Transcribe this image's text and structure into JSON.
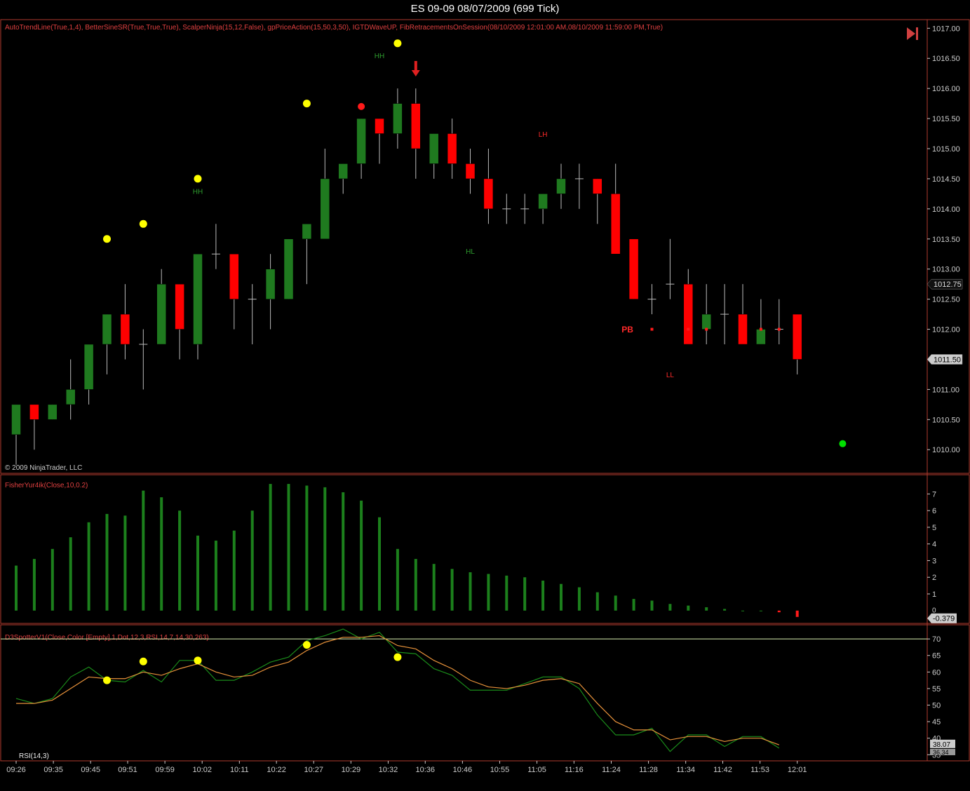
{
  "window": {
    "title": "ES 09-09  08/07/2009 (699 Tick)"
  },
  "price_panel": {
    "indicators_label": "AutoTrendLine(True,1,4), BetterSineSR(True,True,True), ScalperNinja(15,12,False), gpPriceAction(15,50,3,50), IGTDWaveUP, FibRetracementsOnSession(08/10/2009 12:01:00 AM,08/10/2009 11:59:00 PM,True)",
    "copyright": "© 2009 NinjaTrader, LLC",
    "current_price_box": "1011.50",
    "marker_price_box": "1012.75"
  },
  "fisher_panel": {
    "label": "FisherYur4ik(Close,10,0.2)",
    "value_box": "-0.379",
    "zero_label": "0"
  },
  "rsi_panel": {
    "label": "D3SpotterV1(Close,Color [Empty],1,Dot,12,3,RSI,14,7,14,30,263)",
    "rsi_label": "RSI(14,3)",
    "value_box_1": "38.07",
    "value_box_2": "36.34"
  },
  "colors": {
    "up": "#1f7a1f",
    "down": "#ff0000",
    "wick": "#bbbbbb",
    "border": "#b03a2e",
    "axis_text": "#cccccc",
    "yellow_dot": "#ffff00",
    "rsi_green": "#1a8c1a",
    "rsi_orange": "#e8923a",
    "level_line": "#d9f0b0"
  },
  "chart_data": [
    {
      "type": "candlestick",
      "ylim": [
        1009.7,
        1017.05
      ],
      "y_ticks": [
        "1010.00",
        "1010.50",
        "1011.00",
        "1011.50",
        "1012.00",
        "1012.50",
        "1013.00",
        "1013.50",
        "1014.00",
        "1014.50",
        "1015.00",
        "1015.50",
        "1016.00",
        "1016.50",
        "1017.00"
      ],
      "x_ticks": [
        "09:26",
        "09:35",
        "09:45",
        "09:51",
        "09:59",
        "10:02",
        "10:11",
        "10:22",
        "10:27",
        "10:29",
        "10:32",
        "10:36",
        "10:46",
        "10:55",
        "11:05",
        "11:16",
        "11:24",
        "11:28",
        "11:34",
        "11:42",
        "11:53",
        "12:01"
      ],
      "bars": [
        {
          "o": 1010.25,
          "h": 1010.75,
          "l": 1009.75,
          "c": 1010.75
        },
        {
          "o": 1010.75,
          "h": 1010.75,
          "l": 1010.0,
          "c": 1010.5
        },
        {
          "o": 1010.5,
          "h": 1010.75,
          "l": 1010.5,
          "c": 1010.75
        },
        {
          "o": 1010.75,
          "h": 1011.5,
          "l": 1010.5,
          "c": 1011.0
        },
        {
          "o": 1011.0,
          "h": 1011.75,
          "l": 1010.75,
          "c": 1011.75
        },
        {
          "o": 1011.75,
          "h": 1012.25,
          "l": 1011.25,
          "c": 1012.25
        },
        {
          "o": 1012.25,
          "h": 1012.75,
          "l": 1011.5,
          "c": 1011.75
        },
        {
          "o": 1011.75,
          "h": 1012.0,
          "l": 1011.0,
          "c": 1011.75
        },
        {
          "o": 1011.75,
          "h": 1013.0,
          "l": 1011.75,
          "c": 1012.75
        },
        {
          "o": 1012.75,
          "h": 1012.75,
          "l": 1011.5,
          "c": 1012.0
        },
        {
          "o": 1011.75,
          "h": 1013.25,
          "l": 1011.5,
          "c": 1013.25
        },
        {
          "o": 1013.25,
          "h": 1013.75,
          "l": 1013.0,
          "c": 1013.25
        },
        {
          "o": 1013.25,
          "h": 1013.25,
          "l": 1012.0,
          "c": 1012.5
        },
        {
          "o": 1012.5,
          "h": 1012.75,
          "l": 1011.75,
          "c": 1012.5
        },
        {
          "o": 1012.5,
          "h": 1013.25,
          "l": 1012.0,
          "c": 1013.0
        },
        {
          "o": 1012.5,
          "h": 1013.5,
          "l": 1012.5,
          "c": 1013.5
        },
        {
          "o": 1013.5,
          "h": 1013.75,
          "l": 1012.75,
          "c": 1013.75
        },
        {
          "o": 1013.5,
          "h": 1015.0,
          "l": 1013.5,
          "c": 1014.5
        },
        {
          "o": 1014.5,
          "h": 1014.75,
          "l": 1014.25,
          "c": 1014.75
        },
        {
          "o": 1014.75,
          "h": 1015.5,
          "l": 1014.5,
          "c": 1015.5
        },
        {
          "o": 1015.5,
          "h": 1015.5,
          "l": 1014.75,
          "c": 1015.25
        },
        {
          "o": 1015.25,
          "h": 1016.0,
          "l": 1015.0,
          "c": 1015.75
        },
        {
          "o": 1015.75,
          "h": 1016.0,
          "l": 1014.5,
          "c": 1015.0
        },
        {
          "o": 1014.75,
          "h": 1015.25,
          "l": 1014.5,
          "c": 1015.25
        },
        {
          "o": 1015.25,
          "h": 1015.5,
          "l": 1014.5,
          "c": 1014.75
        },
        {
          "o": 1014.75,
          "h": 1015.0,
          "l": 1014.25,
          "c": 1014.5
        },
        {
          "o": 1014.5,
          "h": 1015.0,
          "l": 1013.75,
          "c": 1014.0
        },
        {
          "o": 1014.0,
          "h": 1014.25,
          "l": 1013.75,
          "c": 1014.0
        },
        {
          "o": 1014.0,
          "h": 1014.25,
          "l": 1013.75,
          "c": 1014.0
        },
        {
          "o": 1014.0,
          "h": 1014.25,
          "l": 1013.75,
          "c": 1014.25
        },
        {
          "o": 1014.25,
          "h": 1014.75,
          "l": 1014.0,
          "c": 1014.5
        },
        {
          "o": 1014.5,
          "h": 1014.75,
          "l": 1014.0,
          "c": 1014.5
        },
        {
          "o": 1014.5,
          "h": 1014.5,
          "l": 1013.75,
          "c": 1014.25
        },
        {
          "o": 1014.25,
          "h": 1014.75,
          "l": 1013.25,
          "c": 1013.25
        },
        {
          "o": 1013.5,
          "h": 1013.5,
          "l": 1012.5,
          "c": 1012.5
        },
        {
          "o": 1012.5,
          "h": 1012.75,
          "l": 1012.25,
          "c": 1012.5
        },
        {
          "o": 1012.75,
          "h": 1013.5,
          "l": 1012.5,
          "c": 1012.75
        },
        {
          "o": 1012.75,
          "h": 1013.0,
          "l": 1011.75,
          "c": 1011.75
        },
        {
          "o": 1012.0,
          "h": 1012.75,
          "l": 1011.75,
          "c": 1012.25
        },
        {
          "o": 1012.25,
          "h": 1012.75,
          "l": 1011.75,
          "c": 1012.25
        },
        {
          "o": 1012.25,
          "h": 1012.75,
          "l": 1011.75,
          "c": 1011.75
        },
        {
          "o": 1011.75,
          "h": 1012.5,
          "l": 1011.75,
          "c": 1012.0
        },
        {
          "o": 1012.0,
          "h": 1012.5,
          "l": 1011.75,
          "c": 1012.0
        },
        {
          "o": 1012.25,
          "h": 1012.25,
          "l": 1011.25,
          "c": 1011.5
        }
      ],
      "yellow_dots": [
        {
          "bar": 5,
          "price": 1013.5
        },
        {
          "bar": 7,
          "price": 1013.75
        },
        {
          "bar": 10,
          "price": 1014.5
        },
        {
          "bar": 16,
          "price": 1015.75
        },
        {
          "bar": 21,
          "price": 1016.75
        }
      ],
      "red_dot": {
        "bar": 19,
        "price": 1015.7
      },
      "green_dot": {
        "bar": 45.5,
        "price": 1010.1
      },
      "down_arrow": {
        "bar": 22,
        "price": 1016.2
      },
      "annotations": [
        {
          "text": "HH",
          "bar": 10,
          "price": 1014.25,
          "color": "#2e9e2e"
        },
        {
          "text": "HH",
          "bar": 20,
          "price": 1016.5,
          "color": "#2e9e2e"
        },
        {
          "text": "HL",
          "bar": 25,
          "price": 1013.25,
          "color": "#2e9e2e"
        },
        {
          "text": "LH",
          "bar": 29,
          "price": 1015.2,
          "color": "#ff2a2a"
        },
        {
          "text": "LL",
          "bar": 36,
          "price": 1011.2,
          "color": "#ff2a2a"
        },
        {
          "text": "PB",
          "bar": 33.65,
          "price": 1011.95,
          "color": "#ff2a2a",
          "bold": true
        }
      ],
      "small_red_squares": [
        {
          "bar": 35,
          "price": 1012.0
        },
        {
          "bar": 37,
          "price": 1012.0
        },
        {
          "bar": 38,
          "price": 1012.0
        },
        {
          "bar": 41,
          "price": 1012.0
        },
        {
          "bar": 42,
          "price": 1012.0
        }
      ]
    },
    {
      "type": "bar",
      "name": "FisherYur4ik",
      "ylim": [
        -0.6,
        7.9
      ],
      "y_ticks": [
        "1",
        "2",
        "3",
        "4",
        "5",
        "6",
        "7"
      ],
      "values": [
        2.7,
        3.1,
        3.7,
        4.4,
        5.3,
        5.8,
        5.7,
        7.2,
        6.8,
        6.0,
        4.5,
        4.2,
        4.8,
        6.0,
        7.6,
        7.6,
        7.5,
        7.4,
        7.1,
        6.6,
        5.6,
        3.7,
        3.1,
        2.8,
        2.5,
        2.3,
        2.2,
        2.1,
        2.0,
        1.8,
        1.6,
        1.4,
        1.1,
        0.9,
        0.7,
        0.6,
        0.4,
        0.3,
        0.2,
        0.1,
        0.0,
        0.0,
        -0.1,
        -0.379
      ],
      "bar_offset": 0
    },
    {
      "type": "line",
      "name": "RSI",
      "ylim": [
        34,
        73
      ],
      "y_ticks": [
        "35",
        "40",
        "45",
        "50",
        "55",
        "60",
        "65",
        "70"
      ],
      "level": 70,
      "rsi": [
        52,
        50.5,
        52,
        58.5,
        61.5,
        57.5,
        57,
        60.5,
        57,
        63.5,
        63.5,
        57.5,
        57.5,
        60,
        63,
        64.5,
        69.5,
        71,
        73,
        70,
        72,
        66,
        65.5,
        61,
        59,
        54.5,
        54.5,
        54.5,
        56.5,
        58.5,
        58.5,
        55,
        47,
        41,
        41,
        43,
        36,
        41,
        41,
        37.5,
        40.5,
        40.5,
        37
      ],
      "signal": [
        50.5,
        50.5,
        51.5,
        55,
        58.5,
        58,
        58,
        60,
        59,
        61,
        62.5,
        60,
        58.5,
        59,
        61.5,
        63,
        66.5,
        69,
        70.5,
        70.5,
        71,
        68,
        67,
        63.5,
        61,
        57.5,
        55.5,
        55,
        56,
        57.5,
        58,
        56.5,
        50.5,
        45,
        42.5,
        42.5,
        39.5,
        40.5,
        40.5,
        39,
        40,
        40,
        38
      ],
      "yellow_dots": [
        {
          "idx": 5,
          "value": 57.5
        },
        {
          "idx": 7,
          "value": 63.2
        },
        {
          "idx": 10,
          "value": 63.5
        },
        {
          "idx": 16,
          "value": 68.2
        },
        {
          "idx": 21,
          "value": 64.5
        }
      ]
    }
  ]
}
